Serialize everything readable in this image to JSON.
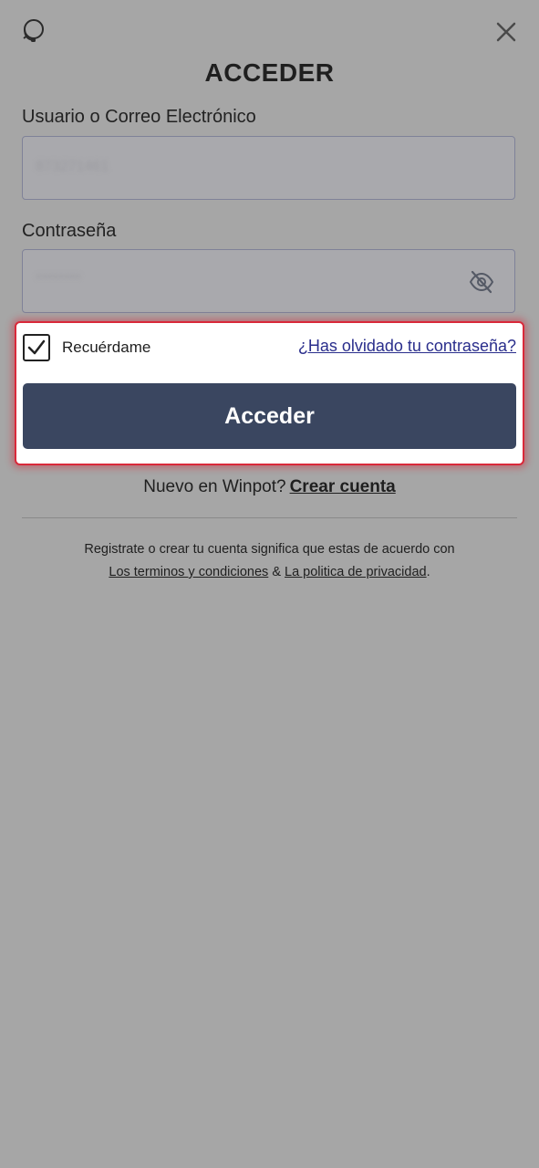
{
  "header": {
    "title": "ACCEDER",
    "support_icon": "headset-icon",
    "close_icon": "close-icon"
  },
  "form": {
    "username_label": "Usuario o Correo Electrónico",
    "username_value": "873271461",
    "password_label": "Contraseña",
    "password_value": "********",
    "password_toggle_icon": "eye-off-icon",
    "remember_label": "Recuérdame",
    "remember_checked": true,
    "forgot_link": "¿Has olvidado tu contraseña?",
    "submit_label": "Acceder"
  },
  "signup": {
    "prompt": "Nuevo en Winpot?",
    "link": "Crear cuenta"
  },
  "legal": {
    "text": "Registrate o crear tu cuenta significa que estas de acuerdo con",
    "terms_link": "Los terminos y condiciones",
    "separator": "&",
    "privacy_link": "La politica de privacidad",
    "end": "."
  },
  "colors": {
    "overlay_background": "#a6a6a6",
    "button": "#3a4660",
    "highlight_border": "#d9293a",
    "link": "#2a2e8c"
  }
}
